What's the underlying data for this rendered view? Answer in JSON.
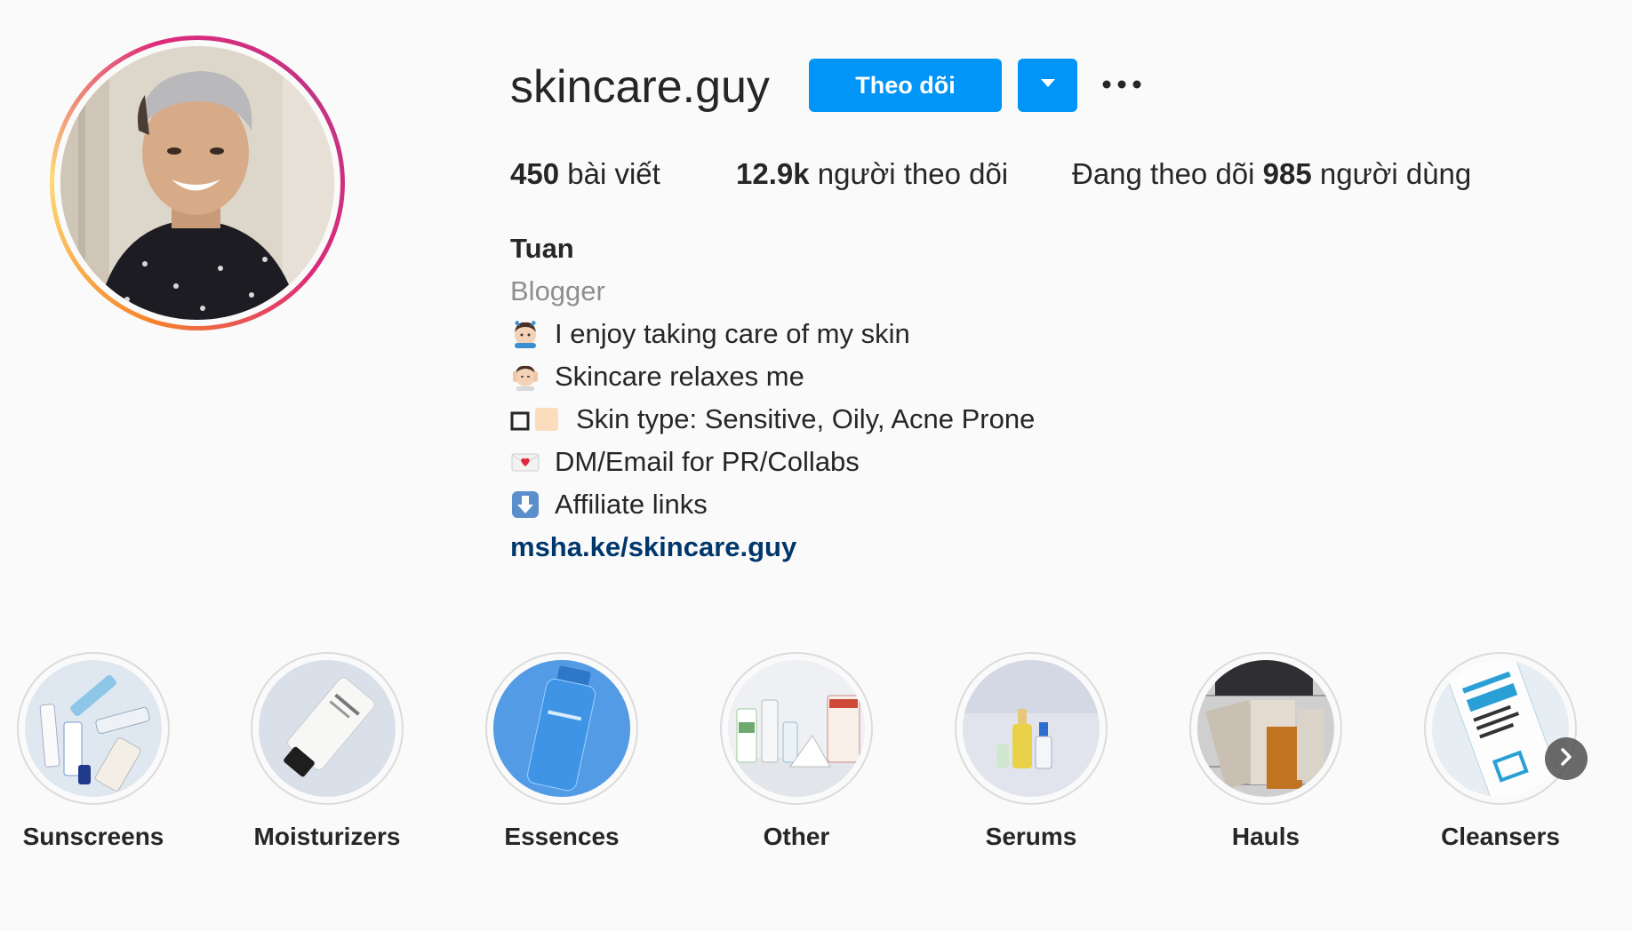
{
  "profile": {
    "username": "skincare.guy",
    "follow_label": "Theo dõi",
    "dropdown_icon": "caret-down-icon",
    "more_icon": "ellipsis-icon"
  },
  "stats": {
    "posts_count": "450",
    "posts_label": "bài viết",
    "followers_count": "12.9k",
    "followers_label": "người theo dõi",
    "following_prefix": "Đang theo dõi",
    "following_count": "985",
    "following_suffix": "người dùng"
  },
  "bio": {
    "name": "Tuan",
    "category": "Blogger",
    "lines": [
      {
        "icon": "man-gesturing-ok-emoji",
        "text": "I enjoy taking care of my skin"
      },
      {
        "icon": "man-getting-face-massage-emoji",
        "text": "Skincare relaxes me"
      },
      {
        "icon": "skin-tone-swatch-emoji",
        "text": "Skin type: Sensitive, Oily, Acne Prone"
      },
      {
        "icon": "love-letter-emoji",
        "text": "DM/Email for PR/Collabs"
      },
      {
        "icon": "down-arrow-emoji",
        "text": "Affiliate links"
      }
    ],
    "link": "msha.ke/skincare.guy"
  },
  "highlights": [
    {
      "label": "Sunscreens"
    },
    {
      "label": "Moisturizers"
    },
    {
      "label": "Essences"
    },
    {
      "label": "Other"
    },
    {
      "label": "Serums"
    },
    {
      "label": "Hauls"
    },
    {
      "label": "Cleansers"
    }
  ],
  "colors": {
    "accent": "#0095f6",
    "link": "#00376b",
    "muted": "#8e8e8e",
    "text": "#262626",
    "background": "#fafafa"
  }
}
